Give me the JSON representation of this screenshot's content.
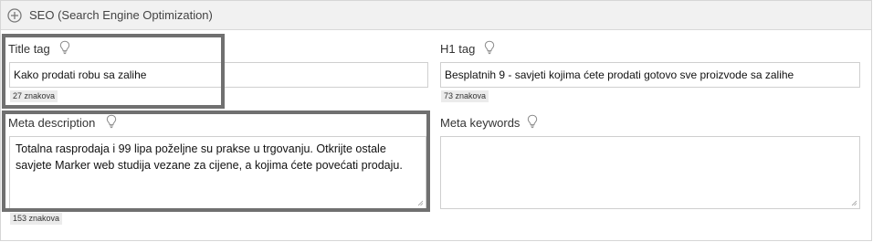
{
  "section": {
    "title": "SEO (Search Engine Optimization)",
    "expand_icon": "plus-circle-icon"
  },
  "fields": {
    "title_tag": {
      "label": "Title tag",
      "value": "Kako prodati robu sa zalihe",
      "count": "27 znakova",
      "hint_icon": "lightbulb-icon"
    },
    "h1_tag": {
      "label": "H1 tag",
      "value": "Besplatnih 9 - savjeti kojima ćete prodati gotovo sve proizvode sa zalihe",
      "count": "73 znakova",
      "hint_icon": "lightbulb-icon"
    },
    "meta_description": {
      "label": "Meta description",
      "value": "Totalna rasprodaja i 99 lipa poželjne su prakse u trgovanju. Otkrijte ostale savjete Marker web studija vezane za cijene, a kojima ćete povećati prodaju.",
      "count": "153 znakova",
      "hint_icon": "lightbulb-icon"
    },
    "meta_keywords": {
      "label": "Meta keywords",
      "value": "",
      "hint_icon": "lightbulb-icon"
    }
  },
  "colors": {
    "header_bg": "#f1f1f1",
    "highlight_border": "#707070",
    "count_bg": "#ebebeb"
  }
}
